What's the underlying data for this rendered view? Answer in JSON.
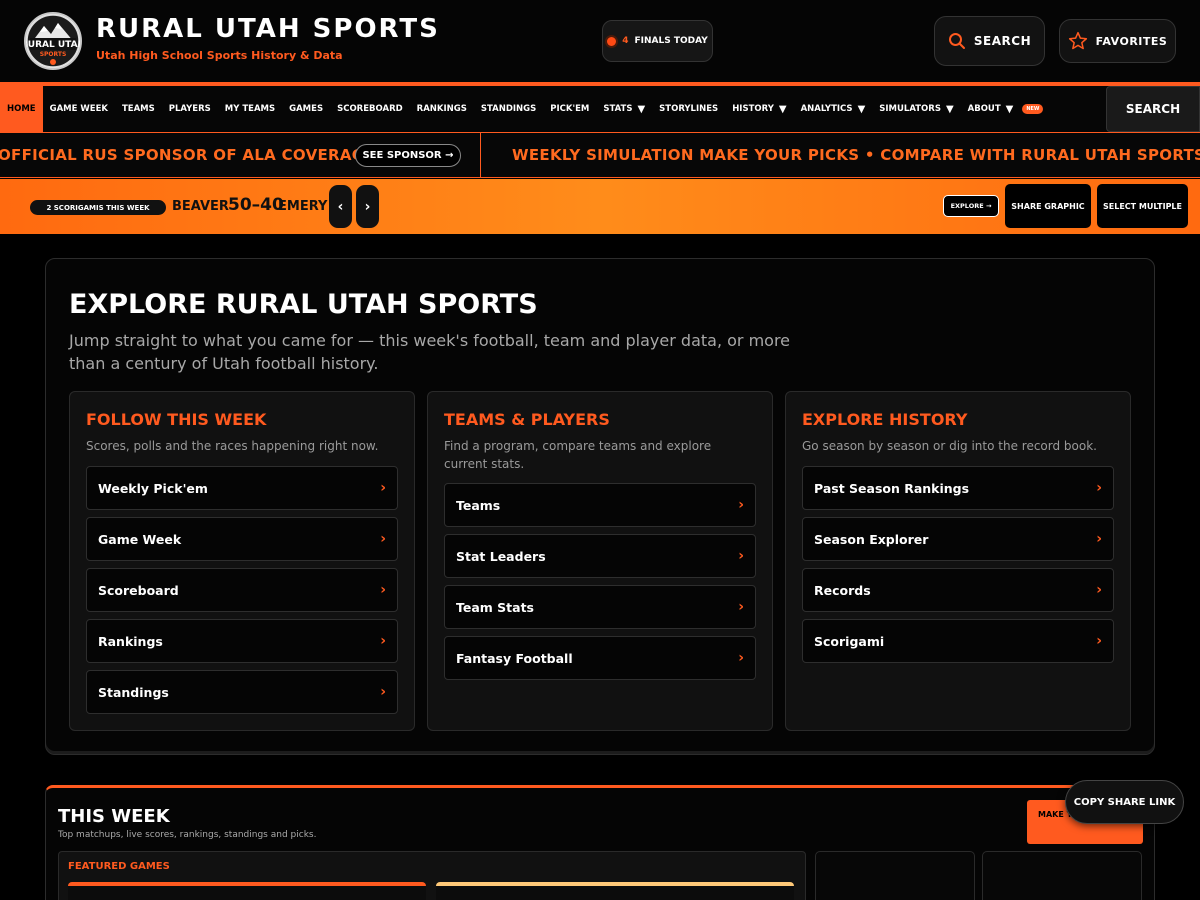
{
  "brand": {
    "logo_text": "RURAL UTAH",
    "logo_subtext": "SPORTS",
    "title": "RURAL UTAH SPORTS",
    "subtitle": "Utah High School Sports History & Data"
  },
  "finals": {
    "count": "4",
    "label": "FINALS TODAY"
  },
  "header": {
    "search_label": "SEARCH",
    "favorites_label": "FAVORITES"
  },
  "nav": {
    "items": [
      {
        "label": "HOME"
      },
      {
        "label": "GAME WEEK"
      },
      {
        "label": "TEAMS"
      },
      {
        "label": "PLAYERS"
      },
      {
        "label": "MY TEAMS"
      },
      {
        "label": "GAMES"
      },
      {
        "label": "SCOREBOARD"
      },
      {
        "label": "RANKINGS"
      },
      {
        "label": "STANDINGS"
      },
      {
        "label": "PICK'EM"
      },
      {
        "label": "STATS"
      },
      {
        "label": "STORYLINES"
      },
      {
        "label": "HISTORY"
      },
      {
        "label": "ANALYTICS"
      },
      {
        "label": "SIMULATORS"
      },
      {
        "label": "ABOUT"
      }
    ],
    "new_badge": "NEW",
    "search_label": "SEARCH"
  },
  "ticker": {
    "sponsor_text": "OFFICIAL RUS SPONSOR OF ALA COVERAGE",
    "sponsor_button": "SEE SPONSOR →",
    "sim_text": "WEEKLY SIMULATION  MAKE YOUR PICKS • COMPARE WITH RURAL UTAH SPORTS • WE"
  },
  "scorigami": {
    "badge": "2 SCORIGAMIS THIS WEEK",
    "team_left": "BEAVER",
    "score": "50–40",
    "team_right": "EMERY",
    "prev": "‹",
    "next": "›",
    "explore_label": "EXPLORE →",
    "share_label": "SHARE GRAPHIC",
    "select_label": "SELECT MULTIPLE"
  },
  "explore": {
    "title": "EXPLORE RURAL UTAH SPORTS",
    "description": "Jump straight to what you came for — this week's football, team and player data, or more than a century of Utah football history.",
    "columns": [
      {
        "title": "FOLLOW THIS WEEK",
        "description": "Scores, polls and the races happening right now.",
        "links": [
          {
            "label": "Weekly Pick'em"
          },
          {
            "label": "Game Week"
          },
          {
            "label": "Scoreboard"
          },
          {
            "label": "Rankings"
          },
          {
            "label": "Standings"
          }
        ]
      },
      {
        "title": "TEAMS & PLAYERS",
        "description": "Find a program, compare teams and explore current stats.",
        "links": [
          {
            "label": "Teams"
          },
          {
            "label": "Stat Leaders"
          },
          {
            "label": "Team Stats"
          },
          {
            "label": "Fantasy Football"
          }
        ]
      },
      {
        "title": "EXPLORE HISTORY",
        "description": "Go season by season or dig into the record book.",
        "links": [
          {
            "label": "Past Season Rankings"
          },
          {
            "label": "Season Explorer"
          },
          {
            "label": "Records"
          },
          {
            "label": "Scorigami"
          }
        ]
      }
    ]
  },
  "this_week": {
    "title": "THIS WEEK",
    "description": "Top matchups, live scores, rankings, standings and picks.",
    "make_button": "MAKE YOUR PICKS",
    "featured_title": "FEATURED GAMES"
  },
  "copy_share_link": "COPY SHARE LINK",
  "colors": {
    "accent": "#ff5a1f",
    "background": "#000000",
    "panel": "#111111"
  }
}
